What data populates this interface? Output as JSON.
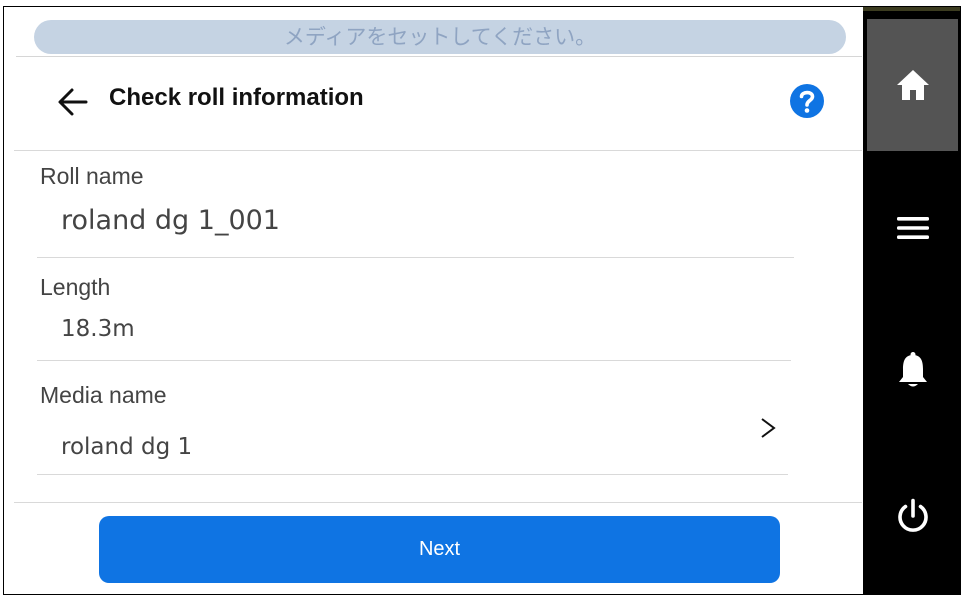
{
  "status": {
    "message": "メディアをセットしてください。"
  },
  "header": {
    "title": "Check roll information"
  },
  "fields": {
    "roll_name": {
      "label": "Roll name",
      "value": "roland dg 1_001"
    },
    "length": {
      "label": "Length",
      "value": "18.3m"
    },
    "media_name": {
      "label": "Media name",
      "value": "roland dg 1"
    }
  },
  "actions": {
    "next_label": "Next"
  },
  "sidebar": {
    "items": [
      {
        "name": "home",
        "icon": "home-icon",
        "active": true
      },
      {
        "name": "menu",
        "icon": "menu-icon",
        "active": false
      },
      {
        "name": "notifications",
        "icon": "bell-icon",
        "active": false
      },
      {
        "name": "power",
        "icon": "power-icon",
        "active": false
      }
    ]
  },
  "colors": {
    "accent": "#0f74e3",
    "status_bar_bg": "#c5d3e3",
    "status_bar_text": "#8fa4c2",
    "sidebar_bg": "#000000",
    "sidebar_active": "#545454"
  }
}
